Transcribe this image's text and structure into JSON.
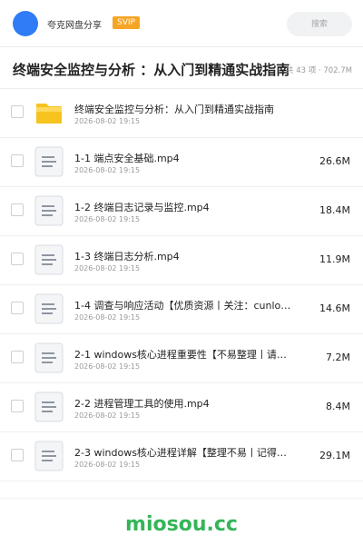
{
  "header": {
    "site_name": "夸克网盘分享",
    "badge": "SVIP",
    "search_placeholder": "搜索"
  },
  "folder": {
    "title": "终端安全监控与分析 ：从入门到精通实战指南",
    "stats": "共 43 项 · 702.7M"
  },
  "items": [
    {
      "type": "folder",
      "name": "终端安全监控与分析：从入门到精通实战指南",
      "date": "2026-08-02 19:15",
      "size": ""
    },
    {
      "type": "file",
      "name": "1-1 端点安全基础.mp4",
      "date": "2026-08-02 19:15",
      "size": "26.6M"
    },
    {
      "type": "file",
      "name": "1-2 终端日志记录与监控.mp4",
      "date": "2026-08-02 19:15",
      "size": "18.4M"
    },
    {
      "type": "file",
      "name": "1-3 终端日志分析.mp4",
      "date": "2026-08-02 19:15",
      "size": "11.9M"
    },
    {
      "type": "file",
      "name": "1-4 调查与响应活动【优质资源丨关注：cunlo…",
      "date": "2026-08-02 19:15",
      "size": "14.6M"
    },
    {
      "type": "file",
      "name": "2-1 windows核心进程重要性【不易整理丨请…",
      "date": "2026-08-02 19:15",
      "size": "7.2M"
    },
    {
      "type": "file",
      "name": "2-2 进程管理工具的使用.mp4",
      "date": "2026-08-02 19:15",
      "size": "8.4M"
    },
    {
      "type": "file",
      "name": "2-3 windows核心进程详解【整理不易丨记得…",
      "date": "2026-08-02 19:15",
      "size": "29.1M"
    }
  ],
  "footer": {
    "brand": "miosou.cc"
  },
  "colors": {
    "avatar": "#2f7cf6",
    "badge": "#f6a524",
    "folder_icon": "#f7c31f",
    "brand": "#35b558"
  }
}
